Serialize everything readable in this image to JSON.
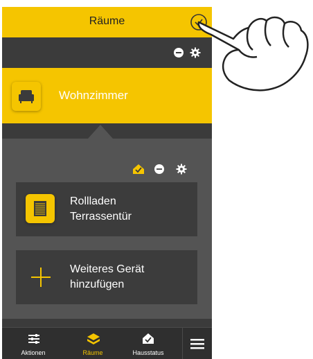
{
  "header": {
    "title": "Räume",
    "confirm_icon": "check-circle-icon"
  },
  "room_toolbar": {
    "icons": [
      "minus-circle-icon",
      "gear-icon"
    ]
  },
  "room": {
    "name": "Wohnzimmer",
    "icon": "armchair-icon"
  },
  "panel": {
    "toolbar_icons": [
      "house-check-icon",
      "minus-circle-icon",
      "gear-icon"
    ],
    "devices": [
      {
        "line1": "Rollladen",
        "line2": "Terrassentür",
        "icon": "roller-shutter-icon"
      }
    ],
    "add_device": {
      "line1": "Weiteres Gerät",
      "line2": "hinzufügen",
      "icon": "plus-icon"
    }
  },
  "tabbar": {
    "tabs": [
      {
        "label": "Aktionen",
        "icon": "actions-icon",
        "active": false
      },
      {
        "label": "Räume",
        "icon": "rooms-icon",
        "active": true
      },
      {
        "label": "Hausstatus",
        "icon": "house-status-icon",
        "active": false
      }
    ],
    "menu_icon": "hamburger-menu-icon"
  },
  "colors": {
    "accent": "#f5c500",
    "background": "#3b3b3b",
    "panel": "#545454",
    "card": "#3c3c3c"
  }
}
